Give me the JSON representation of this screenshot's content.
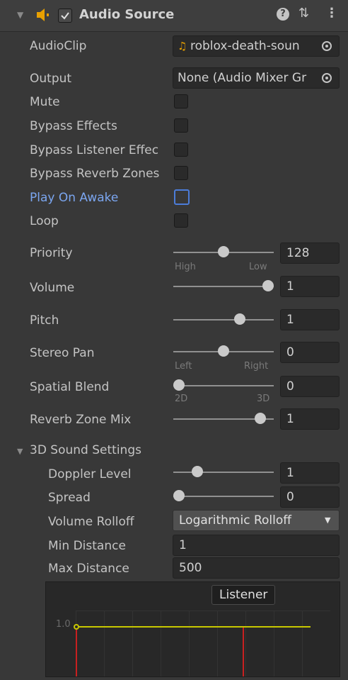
{
  "header": {
    "title": "Audio Source",
    "enabled": true,
    "icons": [
      "collapse-arrow-icon",
      "speaker-icon",
      "help-icon",
      "preset-icon",
      "kebab-menu-icon"
    ]
  },
  "audio_clip": {
    "label": "AudioClip",
    "value": "roblox-death-soun"
  },
  "output": {
    "label": "Output",
    "value": "None (Audio Mixer Gr"
  },
  "toggles": [
    {
      "label": "Mute",
      "checked": false
    },
    {
      "label": "Bypass Effects",
      "checked": false
    },
    {
      "label": "Bypass Listener Effec",
      "checked": false
    },
    {
      "label": "Bypass Reverb Zones",
      "checked": false
    },
    {
      "label": "Play On Awake",
      "checked": false,
      "highlighted": true
    },
    {
      "label": "Loop",
      "checked": false
    }
  ],
  "sliders": {
    "priority": {
      "label": "Priority",
      "value": "128",
      "min_label": "High",
      "max_label": "Low",
      "fraction": 0.5
    },
    "volume": {
      "label": "Volume",
      "value": "1",
      "fraction": 1.0
    },
    "pitch": {
      "label": "Pitch",
      "value": "1",
      "fraction": 0.67
    },
    "stereo_pan": {
      "label": "Stereo Pan",
      "value": "0",
      "min_label": "Left",
      "max_label": "Right",
      "fraction": 0.5
    },
    "spatial_blend": {
      "label": "Spatial Blend",
      "value": "0",
      "min_label": "2D",
      "max_label": "3D",
      "fraction": 0.0
    },
    "reverb_zone_mix": {
      "label": "Reverb Zone Mix",
      "value": "1",
      "fraction": 0.91
    }
  },
  "sound3d": {
    "section_label": "3D Sound Settings",
    "doppler": {
      "label": "Doppler Level",
      "value": "1",
      "fraction": 0.2
    },
    "spread": {
      "label": "Spread",
      "value": "0",
      "fraction": 0.0
    },
    "rolloff": {
      "label": "Volume Rolloff",
      "value": "Logarithmic Rolloff"
    },
    "min_distance": {
      "label": "Min Distance",
      "value": "1"
    },
    "max_distance": {
      "label": "Max Distance",
      "value": "500"
    }
  },
  "graph": {
    "listener_label": "Listener",
    "y_label": "1.0"
  },
  "colors": {
    "accent": "#4c7cd8",
    "curve": "#c8c800",
    "marker": "#c82020",
    "audio_icon": "#e8a000"
  }
}
